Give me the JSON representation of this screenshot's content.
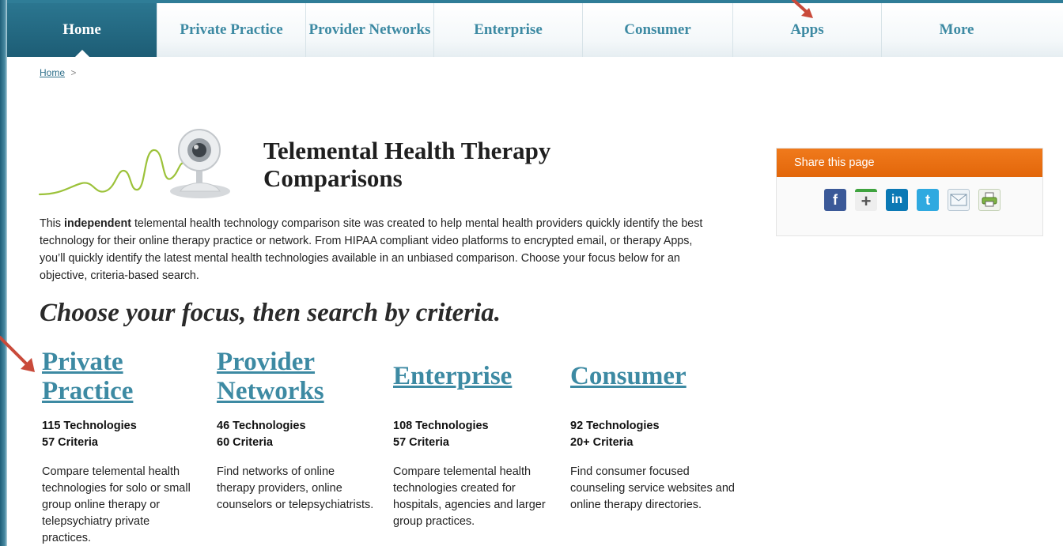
{
  "nav": {
    "items": [
      {
        "label": "Home"
      },
      {
        "label": "Private Practice"
      },
      {
        "label": "Provider Networks"
      },
      {
        "label": "Enterprise"
      },
      {
        "label": "Consumer"
      },
      {
        "label": "Apps"
      },
      {
        "label": "More"
      }
    ]
  },
  "breadcrumb": {
    "home": "Home",
    "separator": ">"
  },
  "header": {
    "title_line1": "Telemental Health Therapy",
    "title_line2": "Comparisons"
  },
  "intro": {
    "lead": "This ",
    "bold": "independent",
    "rest": " telemental health technology comparison site was created to help mental health providers quickly identify the best technology for their online therapy practice or network. From HIPAA compliant video platforms to encrypted email, or therapy Apps, you’ll quickly identify the latest mental health technologies available in an unbiased comparison. Choose your focus below for an objective, criteria-based search."
  },
  "focus_heading": "Choose your focus, then search by criteria.",
  "columns": [
    {
      "title_line1": "Private",
      "title_line2": "Practice",
      "technologies": "115 Technologies",
      "criteria": "57 Criteria",
      "desc": "Compare telemental health technologies for solo or small group online therapy or telepsychiatry private practices."
    },
    {
      "title_line1": "Provider",
      "title_line2": "Networks",
      "technologies": "46 Technologies",
      "criteria": "60 Criteria",
      "desc": "Find networks of online therapy providers, online counselors or telepsychiatrists."
    },
    {
      "title_line1": "Enterprise",
      "technologies": "108 Technologies",
      "criteria": "57 Criteria",
      "desc": "Compare telemental health technologies created for hospitals, agencies and larger group practices."
    },
    {
      "title_line1": "Consumer",
      "technologies": "92 Technologies",
      "criteria": "20+ Criteria",
      "desc": "Find consumer focused counseling service websites and online therapy directories."
    }
  ],
  "share": {
    "title": "Share this page",
    "icons": [
      "delicious-icon",
      "facebook-icon",
      "google-plus-icon",
      "linkedin-icon",
      "twitter-icon",
      "email-icon",
      "print-icon"
    ],
    "icon_glyphs": {
      "facebook": "f",
      "google_plus": "+",
      "linkedin": "in",
      "twitter": "t"
    }
  },
  "colors": {
    "nav_active": "#2b7690",
    "link_teal": "#3d8aa3",
    "share_orange": "#e96e12",
    "annotation_arrow": "#c94a3a"
  }
}
